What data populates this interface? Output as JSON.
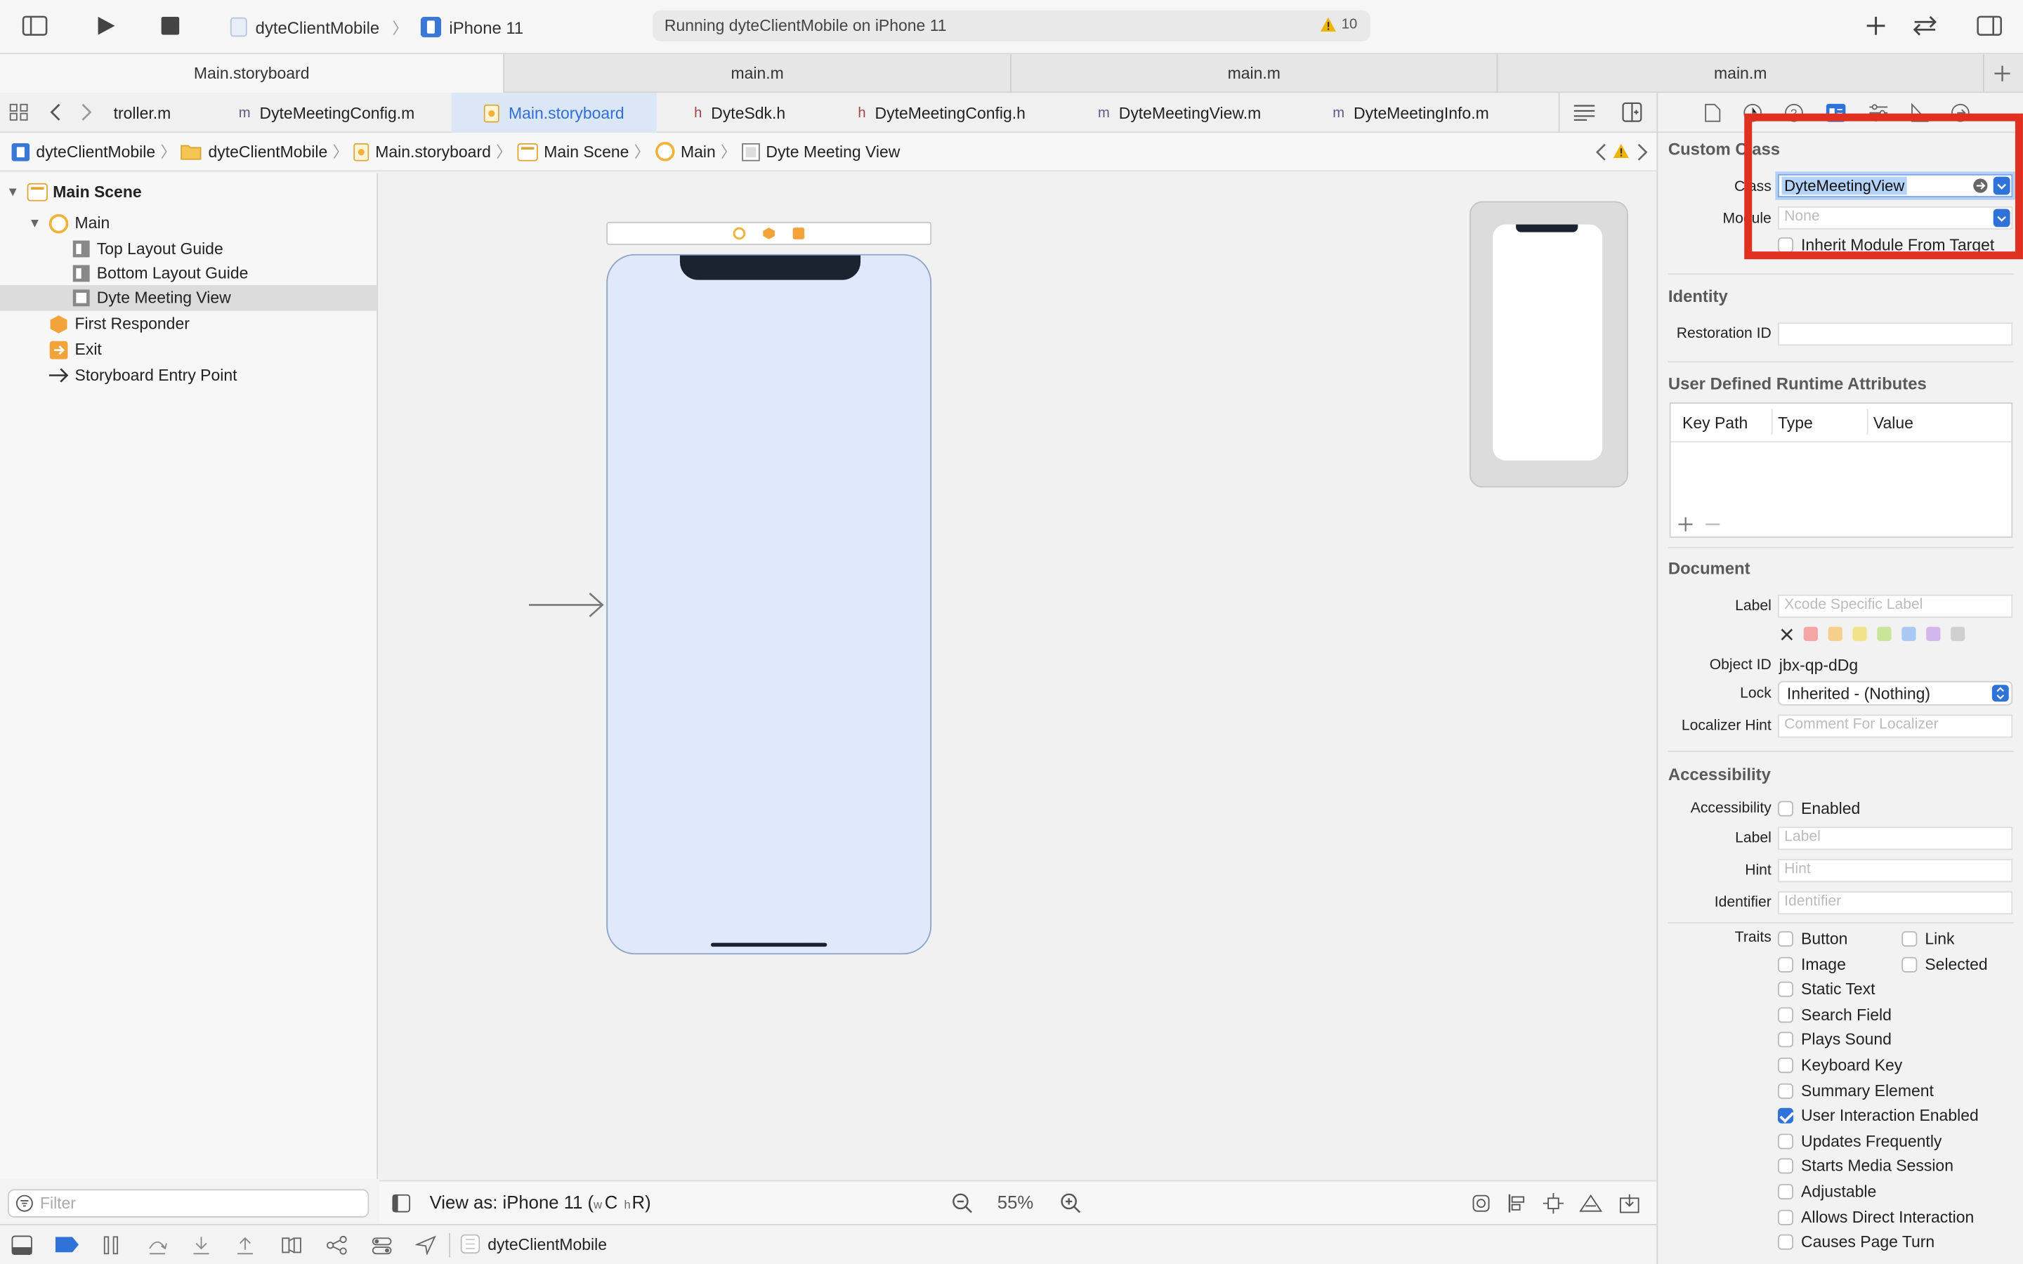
{
  "toolbar": {
    "scheme_project": "dyteClientMobile",
    "scheme_device": "iPhone 11",
    "status_text": "Running dyteClientMobile on iPhone 11",
    "warning_count": "10"
  },
  "editor_tabs": [
    "Main.storyboard",
    "main.m",
    "main.m",
    "main.m"
  ],
  "file_tabs": [
    {
      "prefix": "",
      "label": "troller.m"
    },
    {
      "prefix": "m",
      "label": "DyteMeetingConfig.m"
    },
    {
      "prefix": "",
      "label": "Main.storyboard"
    },
    {
      "prefix": "h",
      "label": "DyteSdk.h"
    },
    {
      "prefix": "h",
      "label": "DyteMeetingConfig.h"
    },
    {
      "prefix": "m",
      "label": "DyteMeetingView.m"
    },
    {
      "prefix": "m",
      "label": "DyteMeetingInfo.m"
    }
  ],
  "breadcrumb": [
    "dyteClientMobile",
    "dyteClientMobile",
    "Main.storyboard",
    "Main Scene",
    "Main",
    "Dyte Meeting View"
  ],
  "navigator": {
    "scene": "Main Scene",
    "main": "Main",
    "top_guide": "Top Layout Guide",
    "bottom_guide": "Bottom Layout Guide",
    "selected_view": "Dyte Meeting View",
    "first_responder": "First Responder",
    "exit": "Exit",
    "entry_point": "Storyboard Entry Point",
    "filter_placeholder": "Filter"
  },
  "canvas_bottom": {
    "view_as": "View as: iPhone 11 (",
    "w": "w",
    "c": "C",
    "h": "h",
    "r": "R",
    "close_paren": ")",
    "zoom": "55%"
  },
  "debug": {
    "target": "dyteClientMobile"
  },
  "inspector": {
    "custom_class": {
      "title": "Custom Class",
      "class_label": "Class",
      "class_value": "DyteMeetingView",
      "module_label": "Module",
      "module_placeholder": "None",
      "inherit_label": "Inherit Module From Target"
    },
    "identity": {
      "title": "Identity",
      "restoration_label": "Restoration ID"
    },
    "runtime": {
      "title": "User Defined Runtime Attributes",
      "col_key": "Key Path",
      "col_type": "Type",
      "col_value": "Value"
    },
    "document": {
      "title": "Document",
      "label_label": "Label",
      "label_placeholder": "Xcode Specific Label",
      "object_id_label": "Object ID",
      "object_id": "jbx-qp-dDg",
      "lock_label": "Lock",
      "lock_value": "Inherited - (Nothing)",
      "localizer_label": "Localizer Hint",
      "localizer_placeholder": "Comment For Localizer",
      "label_colors": [
        "#f4a6a6",
        "#f5cf8c",
        "#f2e38b",
        "#c9e59a",
        "#a9c8f3",
        "#d4b6ee",
        "#cfcfcf"
      ]
    },
    "accessibility": {
      "title": "Accessibility",
      "accessibility_label": "Accessibility",
      "enabled": "Enabled",
      "label_label": "Label",
      "label_placeholder": "Label",
      "hint_label": "Hint",
      "hint_placeholder": "Hint",
      "identifier_label": "Identifier",
      "identifier_placeholder": "Identifier",
      "traits_label": "Traits",
      "traits_left": [
        {
          "label": "Button",
          "checked": false
        },
        {
          "label": "Image",
          "checked": false
        },
        {
          "label": "Static Text",
          "checked": false
        },
        {
          "label": "Search Field",
          "checked": false
        },
        {
          "label": "Plays Sound",
          "checked": false
        },
        {
          "label": "Keyboard Key",
          "checked": false
        },
        {
          "label": "Summary Element",
          "checked": false
        },
        {
          "label": "User Interaction Enabled",
          "checked": true
        },
        {
          "label": "Updates Frequently",
          "checked": false
        },
        {
          "label": "Starts Media Session",
          "checked": false
        },
        {
          "label": "Adjustable",
          "checked": false
        },
        {
          "label": "Allows Direct Interaction",
          "checked": false
        },
        {
          "label": "Causes Page Turn",
          "checked": false
        }
      ],
      "traits_right": [
        {
          "label": "Link",
          "checked": false
        },
        {
          "label": "Selected",
          "checked": false
        }
      ]
    }
  },
  "colors": {
    "accent": "#2f73d8",
    "highlight_box": "#e03020",
    "warning": "#f0b400"
  }
}
